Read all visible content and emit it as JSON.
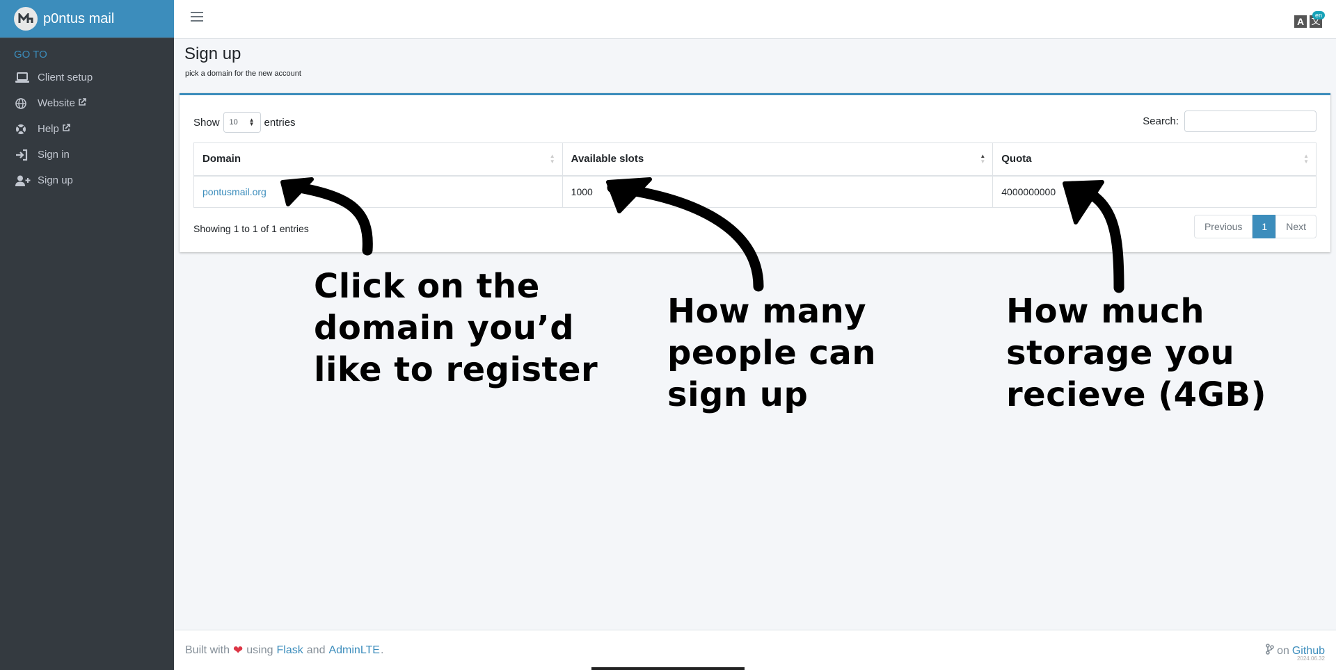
{
  "sidebar": {
    "brand": "p0ntus mail",
    "section_header": "GO TO",
    "items": [
      {
        "label": "Client setup",
        "icon": "laptop-icon"
      },
      {
        "label": "Website",
        "icon": "globe-icon"
      },
      {
        "label": "Help",
        "icon": "lifebuoy-icon"
      },
      {
        "label": "Sign in",
        "icon": "sign-in-icon"
      },
      {
        "label": "Sign up",
        "icon": "user-plus-icon"
      }
    ]
  },
  "topbar": {
    "lang_badge": "en"
  },
  "header": {
    "title": "Sign up",
    "subtitle": "pick a domain for the new account"
  },
  "table_controls": {
    "show_label": "Show",
    "entries_label": "entries",
    "length_value": "10",
    "search_label": "Search:",
    "search_value": ""
  },
  "table": {
    "columns": [
      "Domain",
      "Available slots",
      "Quota"
    ],
    "rows": [
      {
        "domain": "pontusmail.org",
        "slots": "1000",
        "quota": "4000000000"
      }
    ]
  },
  "pagination": {
    "info": "Showing 1 to 1 of 1 entries",
    "previous": "Previous",
    "current": "1",
    "next": "Next"
  },
  "annotations": {
    "domain": "Click on the\ndomain you’d\nlike to register",
    "slots": "How many\npeople can\nsign up",
    "quota": "How much\nstorage you\nrecieve (4GB)"
  },
  "footer": {
    "built_with": "Built with",
    "using": "using",
    "flask": "Flask",
    "and": "and",
    "adminlte": "AdminLTE",
    "period": ".",
    "on": "on",
    "github": "Github",
    "version": "2024.06.32"
  },
  "colors": {
    "accent": "#3c8dbc",
    "sidebar_bg": "#343a40",
    "heart": "#dc3545"
  }
}
